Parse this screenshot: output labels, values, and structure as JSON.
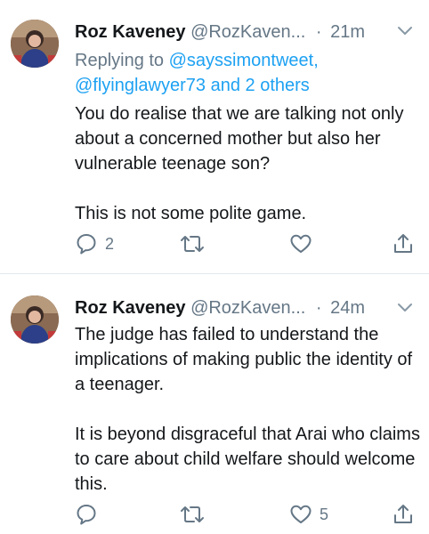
{
  "tweets": [
    {
      "author_name": "Roz Kaveney",
      "handle": "@RozKaven...",
      "separator": "·",
      "time": "21m",
      "replying_prefix": "Replying to",
      "replying_to_1": "@sayssimontweet,",
      "replying_to_2": "@flyinglawyer73 and 2 others",
      "paragraphs": [
        "You do realise that we are talking not only about a concerned mother but also her vulnerable teenage son?",
        "This is not some polite game."
      ],
      "reply_count": "2",
      "retweet_count": "",
      "like_count": ""
    },
    {
      "author_name": "Roz Kaveney",
      "handle": "@RozKaven...",
      "separator": "·",
      "time": "24m",
      "paragraphs": [
        "The judge has failed to understand the implications of making public the identity of a teenager.",
        "It is beyond disgraceful that Arai who claims to care about child welfare should welcome this."
      ],
      "reply_count": "",
      "retweet_count": "",
      "like_count": "5"
    }
  ],
  "icons": {
    "reply": "reply-icon",
    "retweet": "retweet-icon",
    "like": "heart-icon",
    "share": "share-icon",
    "menu": "chevron-down-icon"
  },
  "colors": {
    "text": "#14171a",
    "secondary": "#657786",
    "link": "#1da1f2",
    "divider": "#e1e8ed"
  }
}
